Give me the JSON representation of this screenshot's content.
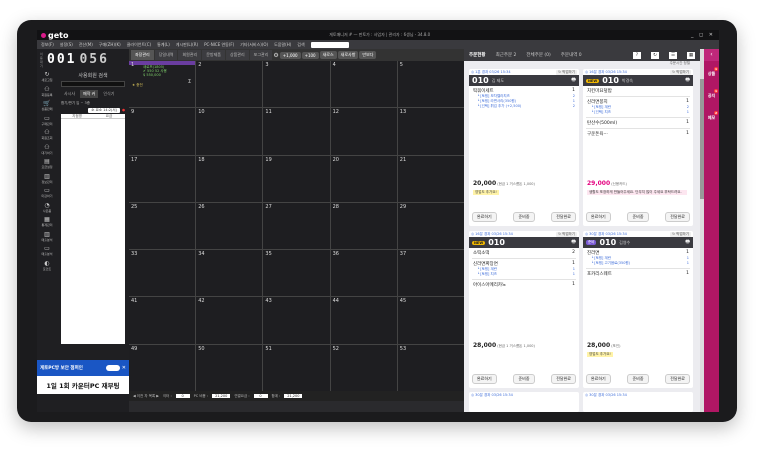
{
  "app": {
    "logo": "geto",
    "title": "게토매니저 # — 판토가 : 사업자 | 관리자 : 6생님 - 34.8.0",
    "window_controls": "_ ◻ ✕"
  },
  "menu": [
    "정보(F)",
    "설정(S)",
    "전산(M)",
    "구매(ZH)(K)",
    "클라이언트(C)",
    "통계(L)",
    "게시판(L)(R)",
    "PC-NICE 연동(F)",
    "기타(서비스)(O)",
    "도움말(H)",
    "검색"
  ],
  "counter": {
    "label_top": "이용",
    "label_bottom": "대기",
    "value1": "001",
    "value2": "056"
  },
  "sidebar_icons": [
    "새로고침",
    "회원등록",
    "상품판매",
    "구매관리",
    "회원조회",
    "대기하기",
    "요금설정",
    "정보관리",
    "마감하기",
    "사은품",
    "통계관리",
    "매출분석",
    "매출분석",
    "포인트"
  ],
  "seat_panel": {
    "search_title": "사용회원 검색",
    "tabs": [
      "사시사",
      "매작 커",
      "인식기"
    ],
    "section": "합기/판기 입 ~ 3종",
    "filter_chip": "소 요소 14:2(서)",
    "columns": [
      "지점명",
      "요금"
    ]
  },
  "banner": {
    "text": "게토PC방 보안 점퍼인"
  },
  "notice": {
    "text": "1일 1회 카운터PC 재부팅"
  },
  "top_tabs": [
    "좌장관리",
    "당일내역",
    "회원관리",
    "문방제품",
    "상품관리",
    "포그관리"
  ],
  "top_pills": [
    "+1,000",
    "+100",
    "새로스",
    "새로사항",
    "만보다"
  ],
  "seats": [
    {
      "n": "1",
      "used": true,
      "lines": [
        "새로프(1805)",
        "✔ 550 52 사용",
        "$ 550,000"
      ],
      "star": "★ 충전"
    },
    {
      "n": "2"
    },
    {
      "n": "3"
    },
    {
      "n": "4"
    },
    {
      "n": "5"
    },
    {
      "n": "9"
    },
    {
      "n": "10"
    },
    {
      "n": "11"
    },
    {
      "n": "12"
    },
    {
      "n": "13"
    },
    {
      "n": "17"
    },
    {
      "n": "18"
    },
    {
      "n": "19"
    },
    {
      "n": "20"
    },
    {
      "n": "21"
    },
    {
      "n": "25"
    },
    {
      "n": "26"
    },
    {
      "n": "27"
    },
    {
      "n": "28"
    },
    {
      "n": "29"
    },
    {
      "n": "33"
    },
    {
      "n": "34"
    },
    {
      "n": "35"
    },
    {
      "n": "36"
    },
    {
      "n": "37"
    },
    {
      "n": "41"
    },
    {
      "n": "42"
    },
    {
      "n": "43"
    },
    {
      "n": "44"
    },
    {
      "n": "45"
    },
    {
      "n": "49"
    },
    {
      "n": "50"
    },
    {
      "n": "51"
    },
    {
      "n": "52"
    },
    {
      "n": "53"
    }
  ],
  "statusbar": {
    "nav": "◀ 이전 자 목록 ▶",
    "items": [
      {
        "label": "이터 :",
        "value": "0"
      },
      {
        "label": "PC 비용 :",
        "value": "21,200"
      },
      {
        "label": "연결요금 :",
        "value": "0"
      },
      {
        "label": "합계 :",
        "value": "21,200"
      }
    ]
  },
  "orders": {
    "tabs": [
      "주문현황",
      "최근주문 2",
      "전체주문 (0)",
      "주문내역 0"
    ],
    "sort_label": "주문시간 정렬",
    "cards": [
      {
        "meta": "◎ 1분 경과 03/26 15:34",
        "pick": "↻ 픽업하기",
        "seat": "010",
        "name": "김 제도",
        "items": [
          {
            "n": "떡볶이세트",
            "q": "1",
            "opts": [
              {
                "n": "└ [토핑] 모차렐라치즈",
                "q": "2"
              },
              {
                "n": "└ [토핑] 라면사리(350원)",
                "q": "1"
              },
              {
                "n": "└ [선택] 튀김 추가 (+2,500)",
                "q": "2"
              }
            ]
          }
        ],
        "total": "20,000",
        "total_note": "(현금 1 거스름돈 1,000)",
        "note": "영업도 추가요!",
        "buttons": [
          "완료하기",
          "준비중",
          "전달완료"
        ]
      },
      {
        "meta": "◎ 16분 경과 03/26 15:34",
        "pick": "↻ 픽업하기",
        "badge": "NEW",
        "seat": "010",
        "name": "박경숙",
        "items": [
          {
            "n": "치킨마요덮밥",
            "q": "",
            "opts": []
          },
          {
            "n": "신라면봉지",
            "q": "1",
            "opts": [
              {
                "n": "└ [토핑] 계란",
                "q": "2"
              },
              {
                "n": "└ [선택] 치즈",
                "q": "1"
              }
            ]
          },
          {
            "n": "탄산수(500ml)",
            "q": "1",
            "opts": []
          },
          {
            "n": "구운돈육···",
            "q": "1",
            "opts": []
          }
        ],
        "total": "29,000",
        "total_note": "(신용카드)",
        "pink": true,
        "note": "생활도 포장하게 만들어주세요. 단무지 많이 주세요 부탁드려요.",
        "note_pink": true,
        "buttons": [
          "완료하기",
          "준비중",
          "전달완료"
        ]
      },
      {
        "meta": "◎ 16분 경과 03/26 15:34",
        "pick": "↻ 픽업하기",
        "badge": "NEW",
        "seat": "010",
        "name": "",
        "items": [
          {
            "n": "소떡소떡",
            "q": "2",
            "opts": []
          },
          {
            "n": "신라면짜장면",
            "q": "1",
            "opts": [
              {
                "n": "└ [토핑] 계란",
                "q": "1"
              },
              {
                "n": "└ [토핑] 치즈",
                "q": "1"
              }
            ]
          },
          {
            "n": "아이스아메리카노",
            "q": "1",
            "opts": []
          }
        ],
        "total": "28,000",
        "total_note": "(현금 1 거스름돈 1,000)",
        "buttons": [
          "완료하기",
          "준비중",
          "전달완료"
        ]
      },
      {
        "meta": "◎ 30분 경과 03/26 15:34",
        "pick": "↻ 픽업하기",
        "badge2": "준비",
        "seat": "010",
        "name": "김영수",
        "items": [
          {
            "n": "진라면",
            "q": "1",
            "opts": [
              {
                "n": "└ [토핑] 계란",
                "q": "1"
              },
              {
                "n": "└ [토핑] 고기음료(350원)",
                "q": "1"
              }
            ]
          },
          {
            "n": "포카리스웨트",
            "q": "1",
            "opts": []
          }
        ],
        "total": "28,000",
        "total_note": "(포인)",
        "note": "영업도 추가요!",
        "buttons": [
          "완료하기",
          "준비중",
          "전달완료"
        ]
      }
    ],
    "peek_left": "◎ 30분 경과 03/26 15:34",
    "peek_right": "◎ 30분 경과 03/26 15:34"
  },
  "right_nav": [
    {
      "label": "상품",
      "badge": "1"
    },
    {
      "label": "공지",
      "badge": "1"
    },
    {
      "label": "메모",
      "badge": "2"
    }
  ]
}
